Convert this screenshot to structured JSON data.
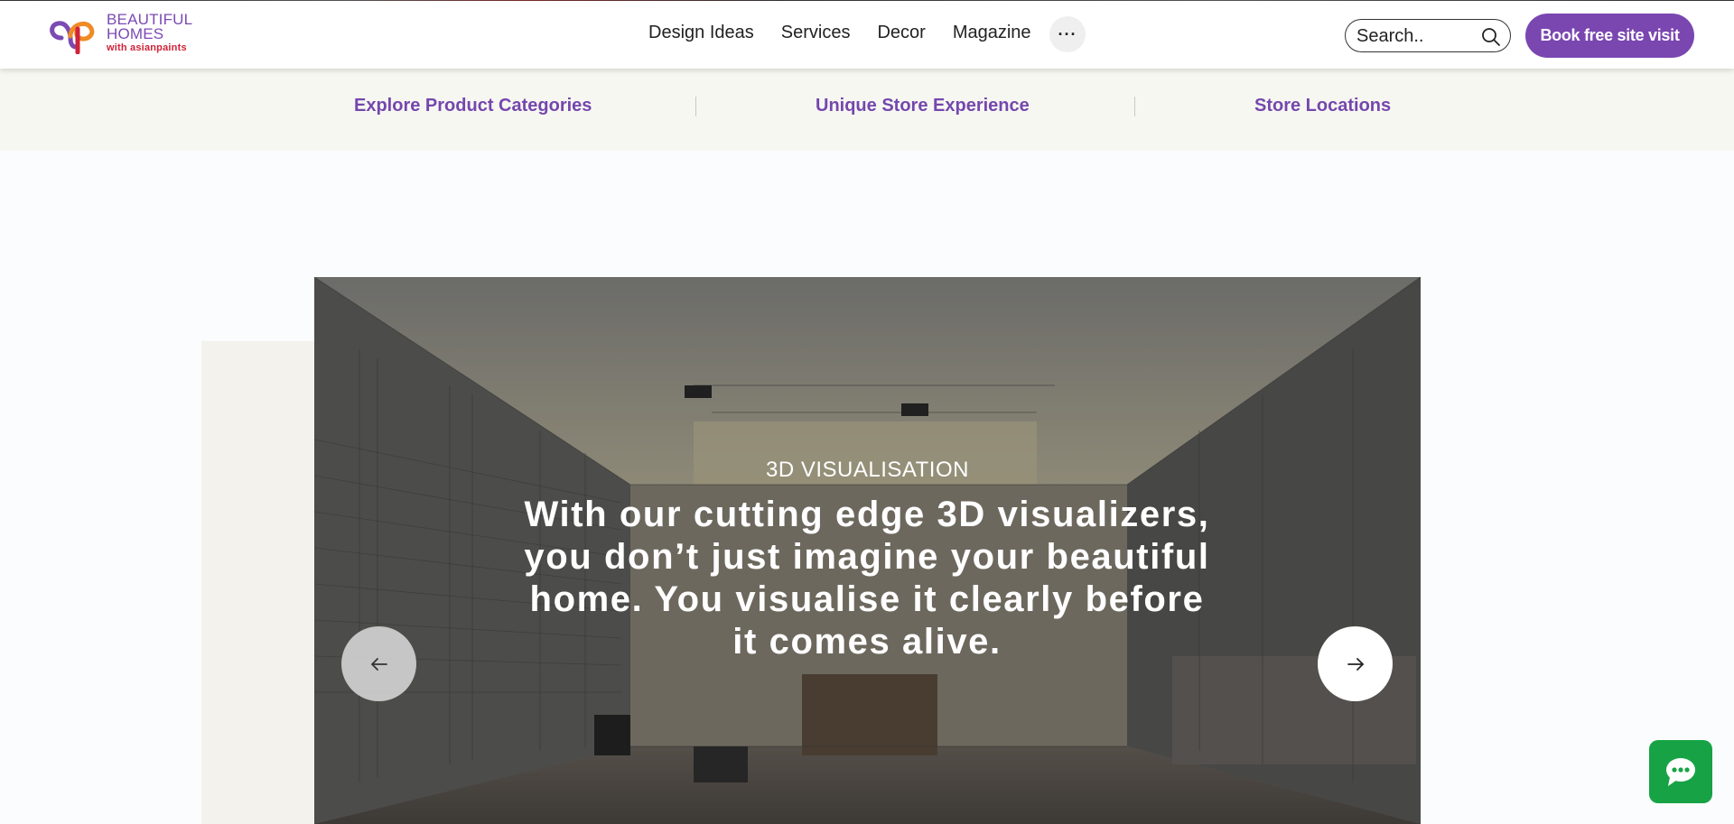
{
  "brand": {
    "line1": "BEAUTIFUL",
    "line2": "HOMES",
    "tagline": "with asianpaints",
    "colors": {
      "purple": "#7b4ab3",
      "red": "#d0233a",
      "orange": "#f08a24"
    }
  },
  "nav": {
    "items": [
      {
        "label": "Design Ideas"
      },
      {
        "label": "Services"
      },
      {
        "label": "Decor"
      },
      {
        "label": "Magazine"
      }
    ],
    "more_icon": "more-dots-icon",
    "more_label": "···"
  },
  "search": {
    "placeholder": "Search..",
    "icon": "search-icon"
  },
  "cta": {
    "label": "Book free site visit",
    "color": "#7a46b0"
  },
  "subnav": {
    "items": [
      {
        "label": "Explore Product Categories"
      },
      {
        "label": "Unique Store Experience"
      },
      {
        "label": "Store Locations"
      }
    ],
    "color": "#7447ad"
  },
  "hero": {
    "eyebrow": "3D VISUALISATION",
    "headline": "With our cutting edge 3D visualizers, you don’t just imagine your beautiful home. You visualise it clearly before it comes alive.",
    "prev_icon": "arrow-left-icon",
    "next_icon": "arrow-right-icon"
  },
  "chat": {
    "icon": "chat-bubble-icon",
    "color": "#17a345"
  }
}
